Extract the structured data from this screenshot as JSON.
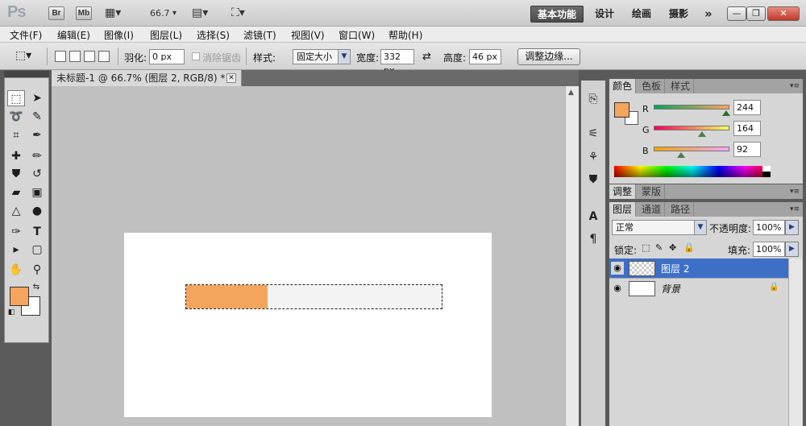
{
  "app": {
    "logo": "Ps",
    "bridge_label": "Br",
    "minibridge_label": "Mb",
    "zoom_value": "66.7",
    "workspaces": [
      "基本功能",
      "设计",
      "绘画",
      "摄影"
    ],
    "more_label": "»"
  },
  "menu": [
    "文件(F)",
    "编辑(E)",
    "图像(I)",
    "图层(L)",
    "选择(S)",
    "滤镜(T)",
    "视图(V)",
    "窗口(W)",
    "帮助(H)"
  ],
  "options": {
    "feather_label": "羽化:",
    "feather_value": "0 px",
    "antialias_label": "消除锯齿",
    "style_label": "样式:",
    "style_value": "固定大小",
    "width_label": "宽度:",
    "width_value": "332 px",
    "height_label": "高度:",
    "height_value": "46 px",
    "refine_edge_label": "调整边缘..."
  },
  "document": {
    "tab_title": "未标题-1 @ 66.7% (图层 2, RGB/8) *",
    "fill_fraction": 0.32
  },
  "colors": {
    "foreground": "#f4a45c",
    "background": "#ffffff"
  },
  "color_panel": {
    "tabs": [
      "颜色",
      "色板",
      "样式"
    ],
    "r_label": "R",
    "g_label": "G",
    "b_label": "B",
    "r_value": "244",
    "g_value": "164",
    "b_value": "92"
  },
  "adjust_panel": {
    "tabs": [
      "调整",
      "蒙版"
    ]
  },
  "layers_panel": {
    "tabs": [
      "图层",
      "通道",
      "路径"
    ],
    "blend_mode": "正常",
    "opacity_label": "不透明度:",
    "opacity_value": "100%",
    "lock_label": "锁定:",
    "fill_label": "填充:",
    "fill_value": "100%",
    "layers": [
      {
        "name": "图层 2",
        "selected": true
      },
      {
        "name": "背景",
        "selected": false
      }
    ]
  }
}
